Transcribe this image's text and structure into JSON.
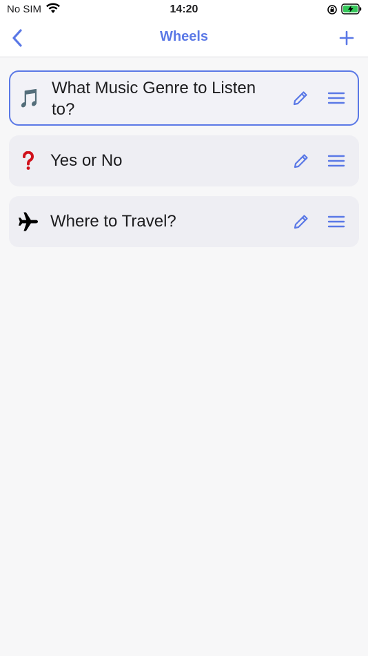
{
  "status_bar": {
    "carrier": "No SIM",
    "time": "14:20",
    "icons": [
      "wifi-icon",
      "orientation-lock-icon",
      "battery-charging-icon"
    ]
  },
  "nav": {
    "title": "Wheels",
    "back_icon": "chevron-left-icon",
    "add_icon": "plus-icon"
  },
  "wheels": [
    {
      "emoji": "🎵",
      "icon": "music-note-icon",
      "label": "What Music Genre to Listen to?",
      "selected": true
    },
    {
      "emoji": "❓",
      "icon": "question-mark-icon",
      "label": "Yes or No",
      "selected": false
    },
    {
      "emoji": "✈",
      "icon": "airplane-icon",
      "label": "Where to Travel?",
      "selected": false
    }
  ],
  "colors": {
    "accent": "#5a78e6",
    "background": "#f7f7f8",
    "card": "#eeeef3",
    "question_red": "#d0111b"
  }
}
